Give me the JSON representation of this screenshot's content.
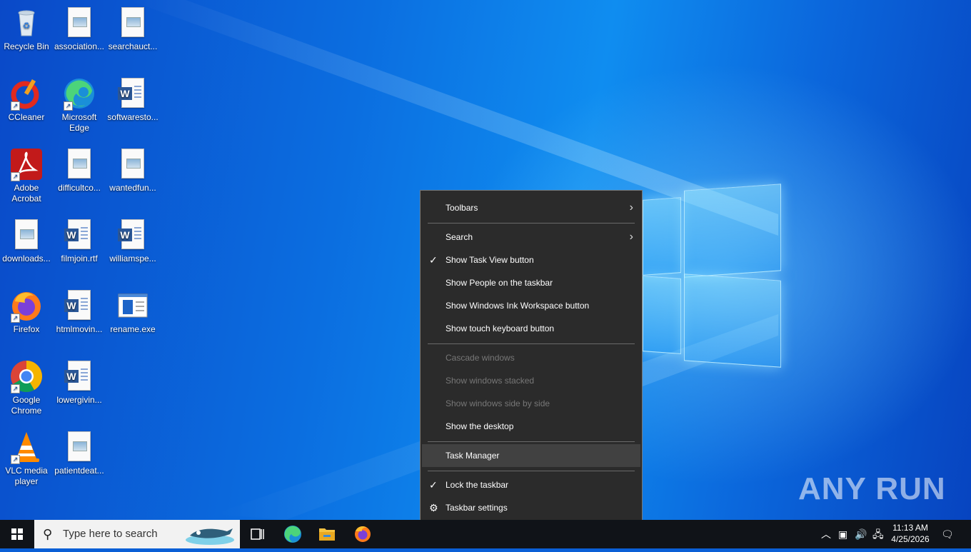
{
  "desktop_icons": [
    {
      "label": "Recycle Bin",
      "icon": "recycle-bin-icon"
    },
    {
      "label": "association...",
      "icon": "image-file-icon"
    },
    {
      "label": "searchauct...",
      "icon": "image-file-icon"
    },
    {
      "label": "CCleaner",
      "icon": "ccleaner-icon"
    },
    {
      "label": "Microsoft Edge",
      "icon": "edge-icon"
    },
    {
      "label": "softwaresto...",
      "icon": "word-doc-icon"
    },
    {
      "label": "Adobe Acrobat",
      "icon": "acrobat-icon"
    },
    {
      "label": "difficultco...",
      "icon": "image-file-icon"
    },
    {
      "label": "wantedfun...",
      "icon": "image-file-icon"
    },
    {
      "label": "downloads...",
      "icon": "image-file-icon"
    },
    {
      "label": "filmjoin.rtf",
      "icon": "word-doc-icon"
    },
    {
      "label": "williamspe...",
      "icon": "word-doc-icon"
    },
    {
      "label": "Firefox",
      "icon": "firefox-icon"
    },
    {
      "label": "htmlmovin...",
      "icon": "word-doc-icon"
    },
    {
      "label": "rename.exe",
      "icon": "exe-icon"
    },
    {
      "label": "Google Chrome",
      "icon": "chrome-icon"
    },
    {
      "label": "lowergivin...",
      "icon": "word-doc-icon"
    },
    {
      "label": "VLC media player",
      "icon": "vlc-icon"
    },
    {
      "label": "patientdeat...",
      "icon": "image-file-icon"
    }
  ],
  "context_menu": {
    "toolbars": "Toolbars",
    "search": "Search",
    "show_task_view": "Show Task View button",
    "show_people": "Show People on the taskbar",
    "show_ink": "Show Windows Ink Workspace button",
    "show_touch_keyboard": "Show touch keyboard button",
    "cascade": "Cascade windows",
    "stacked": "Show windows stacked",
    "side_by_side": "Show windows side by side",
    "show_desktop": "Show the desktop",
    "task_manager": "Task Manager",
    "lock_taskbar": "Lock the taskbar",
    "taskbar_settings": "Taskbar settings"
  },
  "taskbar": {
    "search_placeholder": "Type here to search",
    "time": "11:13 AM",
    "date": "4/25/2026"
  },
  "watermark": "ANY RUN",
  "colors": {
    "menu_bg": "#2b2b2b",
    "menu_hover": "#414141",
    "taskbar_bg": "#101318",
    "desktop_accent": "#0b6ee0"
  }
}
